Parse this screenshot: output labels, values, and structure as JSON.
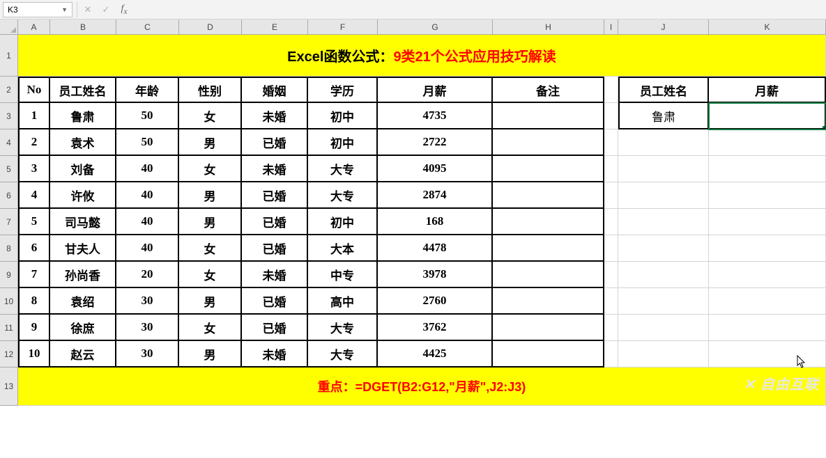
{
  "name_box": "K3",
  "formula_value": "",
  "columns": [
    "A",
    "B",
    "C",
    "D",
    "E",
    "F",
    "G",
    "H",
    "I",
    "J",
    "K"
  ],
  "row_numbers": [
    "1",
    "2",
    "3",
    "4",
    "5",
    "6",
    "7",
    "8",
    "9",
    "10",
    "11",
    "12",
    "13"
  ],
  "title": {
    "black": "Excel函数公式：",
    "red": "9类21个公式应用技巧解读"
  },
  "headers": {
    "no": "No",
    "name": "员工姓名",
    "age": "年龄",
    "gender": "性别",
    "marriage": "婚姻",
    "edu": "学历",
    "salary": "月薪",
    "remark": "备注"
  },
  "lookup_headers": {
    "name": "员工姓名",
    "salary": "月薪"
  },
  "lookup_value": "鲁肃",
  "rows": [
    {
      "no": "1",
      "name": "鲁肃",
      "age": "50",
      "gender": "女",
      "marriage": "未婚",
      "edu": "初中",
      "salary": "4735",
      "remark": ""
    },
    {
      "no": "2",
      "name": "袁术",
      "age": "50",
      "gender": "男",
      "marriage": "已婚",
      "edu": "初中",
      "salary": "2722",
      "remark": ""
    },
    {
      "no": "3",
      "name": "刘备",
      "age": "40",
      "gender": "女",
      "marriage": "未婚",
      "edu": "大专",
      "salary": "4095",
      "remark": ""
    },
    {
      "no": "4",
      "name": "许攸",
      "age": "40",
      "gender": "男",
      "marriage": "已婚",
      "edu": "大专",
      "salary": "2874",
      "remark": ""
    },
    {
      "no": "5",
      "name": "司马懿",
      "age": "40",
      "gender": "男",
      "marriage": "已婚",
      "edu": "初中",
      "salary": "168",
      "remark": ""
    },
    {
      "no": "6",
      "name": "甘夫人",
      "age": "40",
      "gender": "女",
      "marriage": "已婚",
      "edu": "大本",
      "salary": "4478",
      "remark": ""
    },
    {
      "no": "7",
      "name": "孙尚香",
      "age": "20",
      "gender": "女",
      "marriage": "未婚",
      "edu": "中专",
      "salary": "3978",
      "remark": ""
    },
    {
      "no": "8",
      "name": "袁绍",
      "age": "30",
      "gender": "男",
      "marriage": "已婚",
      "edu": "高中",
      "salary": "2760",
      "remark": ""
    },
    {
      "no": "9",
      "name": "徐庶",
      "age": "30",
      "gender": "女",
      "marriage": "已婚",
      "edu": "大专",
      "salary": "3762",
      "remark": ""
    },
    {
      "no": "10",
      "name": "赵云",
      "age": "30",
      "gender": "男",
      "marriage": "未婚",
      "edu": "大专",
      "salary": "4425",
      "remark": ""
    }
  ],
  "footer": {
    "label": "重点：",
    "formula": "=DGET(B2:G12,\"月薪\",J2:J3)"
  },
  "watermark": "自由互联",
  "icons": {
    "cancel": "✕",
    "confirm": "✓"
  }
}
